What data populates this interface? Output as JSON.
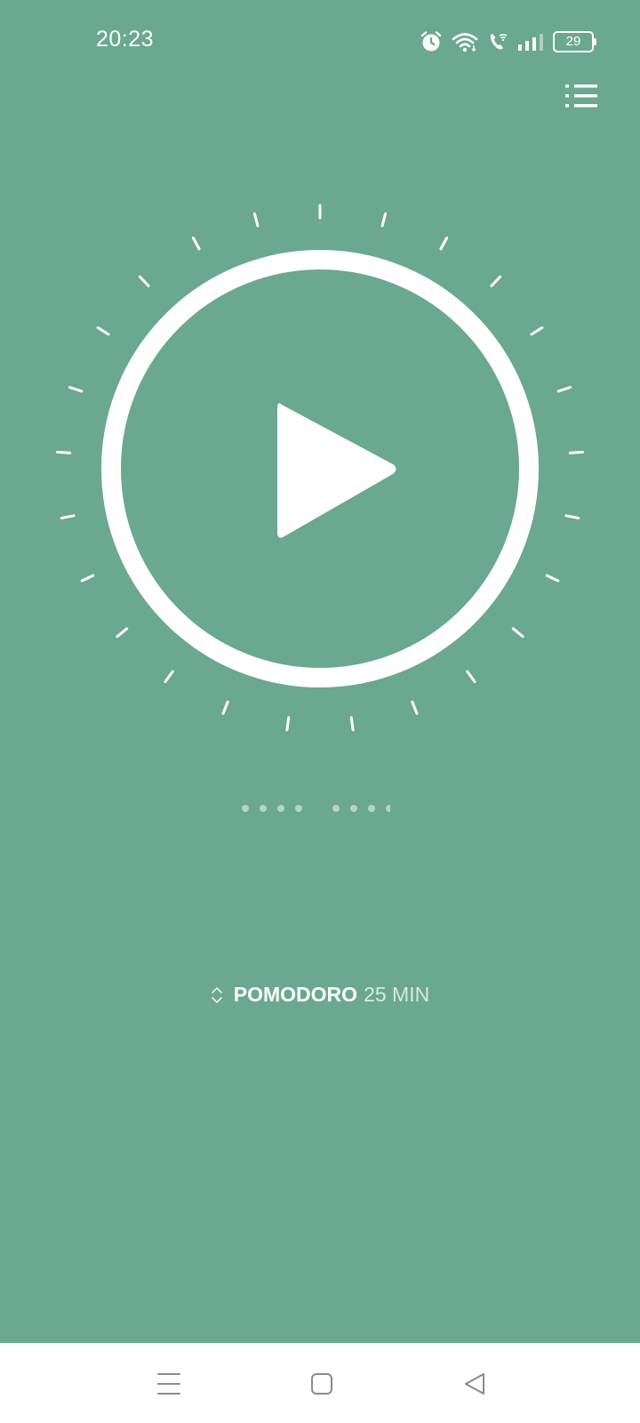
{
  "status_bar": {
    "time": "20:23",
    "icons": [
      "alarm-icon",
      "wifi-icon",
      "wifi-calling-icon",
      "signal-icon"
    ],
    "battery_level": "29"
  },
  "toolbar": {
    "menu_icon": "list-icon"
  },
  "timer": {
    "control_icon": "play-icon",
    "tick_count": 25,
    "sessions_indicator_dots": 8
  },
  "mode": {
    "name": "POMODORO",
    "duration": "25 MIN",
    "icon": "chevron-up-down-icon"
  },
  "nav_bar": {
    "items": [
      "recents-icon",
      "home-icon",
      "back-icon"
    ]
  },
  "colors": {
    "background": "#6aa890",
    "foreground": "#ffffff",
    "nav_background": "#ffffff",
    "nav_icon": "#8a8a8a"
  }
}
